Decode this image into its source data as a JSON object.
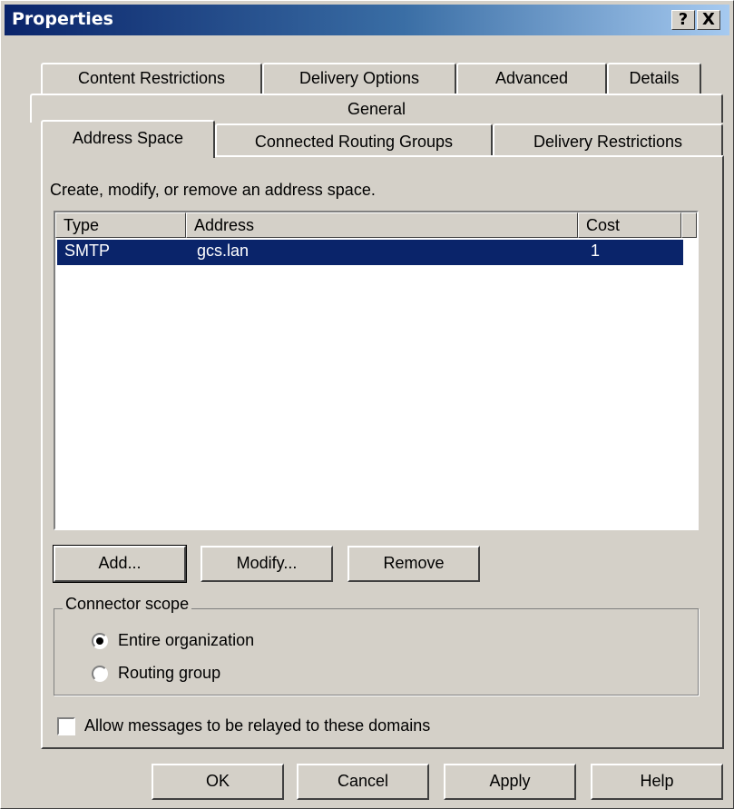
{
  "window": {
    "title": "Properties",
    "help_glyph": "?",
    "close_glyph": "X"
  },
  "tabs": {
    "row1": [
      "Content Restrictions",
      "Delivery Options",
      "Advanced",
      "Details"
    ],
    "row2": [
      "General"
    ],
    "row3": [
      "Address Space",
      "Connected Routing Groups",
      "Delivery Restrictions"
    ],
    "active": "Address Space"
  },
  "address_space": {
    "description": "Create, modify, or remove an address space.",
    "columns": [
      "Type",
      "Address",
      "Cost"
    ],
    "rows": [
      {
        "type": "SMTP",
        "address": "gcs.lan",
        "cost": "1",
        "selected": true
      }
    ]
  },
  "list_buttons": {
    "add": "Add...",
    "modify": "Modify...",
    "remove": "Remove"
  },
  "connector_scope": {
    "label": "Connector scope",
    "options": [
      {
        "label": "Entire organization",
        "checked": true
      },
      {
        "label": "Routing group",
        "checked": false
      }
    ]
  },
  "relay": {
    "label": "Allow messages to be relayed to these domains",
    "checked": false
  },
  "footer": {
    "ok": "OK",
    "cancel": "Cancel",
    "apply": "Apply",
    "help": "Help"
  },
  "colors": {
    "face": "#d4d0c8",
    "titlebar_start": "#0a246a",
    "titlebar_end": "#a6caf0",
    "selection": "#0a246a"
  }
}
